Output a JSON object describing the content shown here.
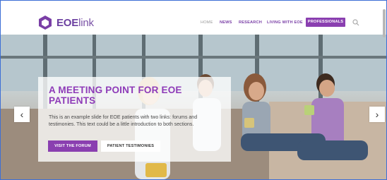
{
  "brand": {
    "name_prefix": "EOE",
    "name_suffix": "link",
    "accent": "#8a3fb0"
  },
  "nav": {
    "items": [
      {
        "label": "HOME"
      },
      {
        "label": "NEWS"
      },
      {
        "label": "RESEARCH"
      },
      {
        "label": "LIVING WITH EOE"
      }
    ],
    "cta_label": "PROFESSIONALS",
    "search_icon": "search-icon"
  },
  "hero": {
    "title": "A MEETING POINT FOR EOE PATIENTS",
    "description": "This is an example slide for EOE patients with two links: forums and testimonies. This text could be a little introduction to both sections.",
    "primary_button": "VISIT THE FORUM",
    "secondary_button": "PATIENT TESTIMONIES",
    "prev_arrow": "‹",
    "next_arrow": "›"
  }
}
